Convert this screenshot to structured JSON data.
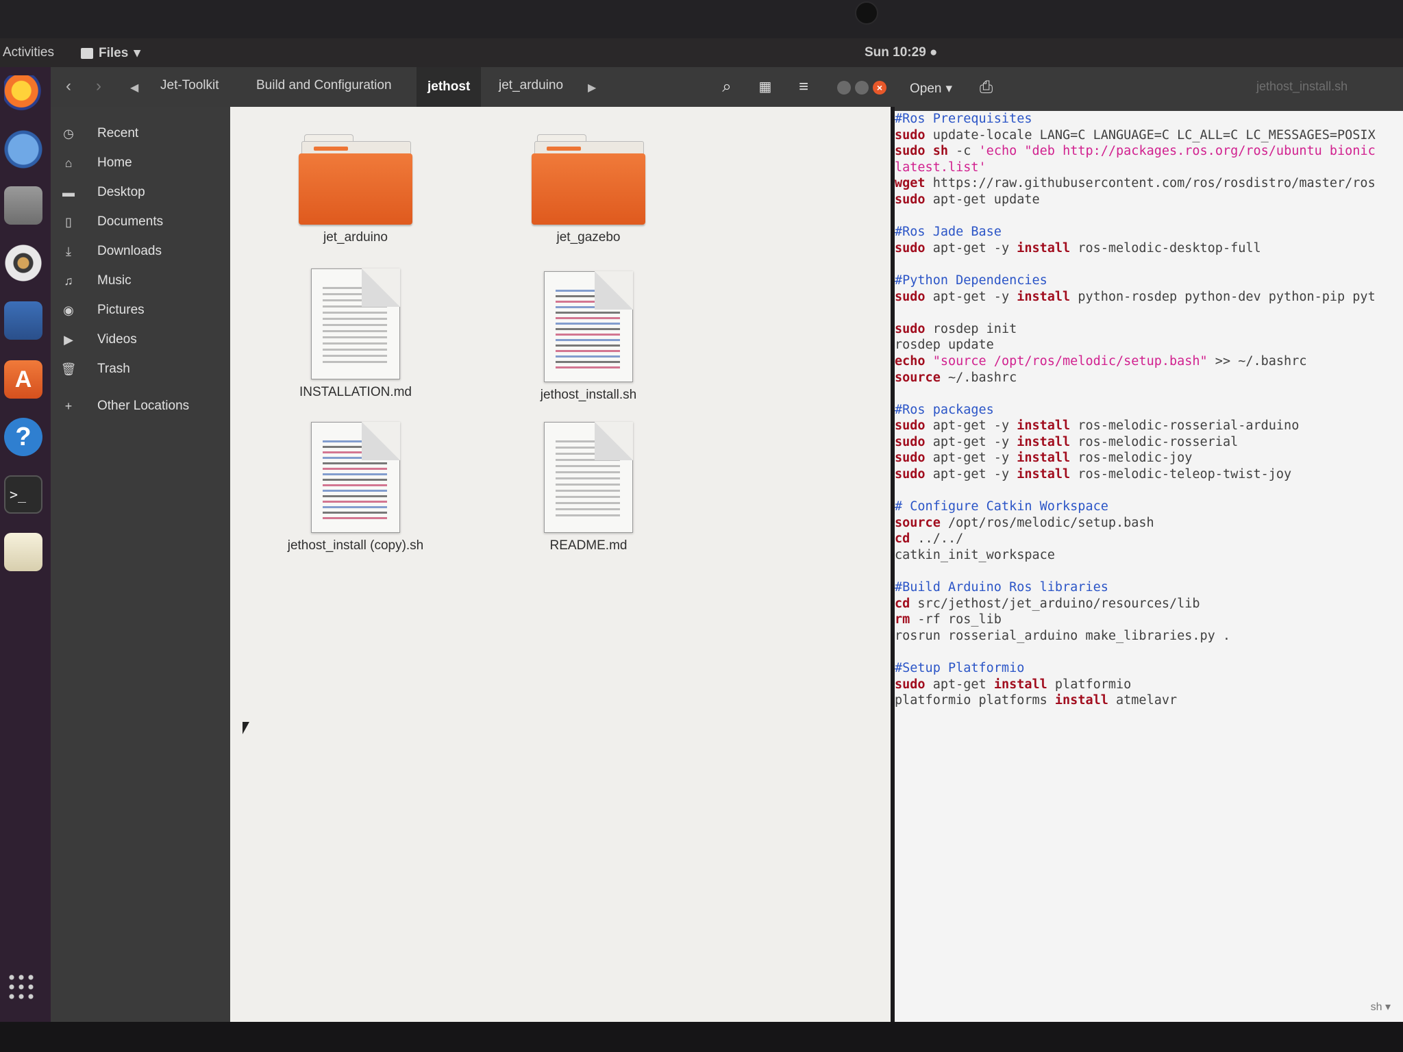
{
  "topbar": {
    "activities": "Activities",
    "app_menu": "Files",
    "clock": "Sun 10:29 ●"
  },
  "dock": {
    "items": [
      "firefox-icon",
      "thunderbird-icon",
      "files-icon",
      "rhythmbox-icon",
      "libreoffice-writer-icon",
      "software-icon",
      "help-icon",
      "terminal-icon",
      "text-editor-icon"
    ]
  },
  "files_window": {
    "breadcrumbs": [
      "Jet-Toolkit",
      "Build and Configuration",
      "jethost",
      "jet_arduino"
    ],
    "active_breadcrumb": "jethost",
    "sidebar": [
      {
        "icon": "clock-icon",
        "label": "Recent"
      },
      {
        "icon": "home-icon",
        "label": "Home"
      },
      {
        "icon": "folder-icon",
        "label": "Desktop"
      },
      {
        "icon": "document-icon",
        "label": "Documents"
      },
      {
        "icon": "download-icon",
        "label": "Downloads"
      },
      {
        "icon": "music-icon",
        "label": "Music"
      },
      {
        "icon": "camera-icon",
        "label": "Pictures"
      },
      {
        "icon": "video-icon",
        "label": "Videos"
      },
      {
        "icon": "trash-icon",
        "label": "Trash"
      },
      {
        "icon": "plus-icon",
        "label": "Other Locations"
      }
    ],
    "items": [
      {
        "name": "jet_arduino",
        "type": "folder"
      },
      {
        "name": "jet_gazebo",
        "type": "folder"
      },
      {
        "name": "INSTALLATION.md",
        "type": "text"
      },
      {
        "name": "jethost_install.sh",
        "type": "script"
      },
      {
        "name": "jethost_install (copy).sh",
        "type": "script"
      },
      {
        "name": "README.md",
        "type": "text"
      }
    ]
  },
  "editor": {
    "open_label": "Open",
    "title": "jethost_install.sh",
    "language": "sh",
    "code": [
      [
        [
          "cm",
          "#Ros Prerequisites"
        ]
      ],
      [
        [
          "kw",
          "sudo"
        ],
        [
          "t",
          " update-locale LANG=C LANGUAGE=C LC_ALL=C LC_MESSAGES=POSIX"
        ]
      ],
      [
        [
          "kw",
          "sudo"
        ],
        [
          "t",
          " "
        ],
        [
          "kw",
          "sh"
        ],
        [
          "t",
          " -c "
        ],
        [
          "st",
          "'echo \"deb http://packages.ros.org/ros/ubuntu bionic"
        ]
      ],
      [
        [
          "st",
          "latest.list'"
        ]
      ],
      [
        [
          "kw",
          "wget"
        ],
        [
          "t",
          " https://raw.githubusercontent.com/ros/rosdistro/master/ros"
        ]
      ],
      [
        [
          "kw",
          "sudo"
        ],
        [
          "t",
          " apt-get update"
        ]
      ],
      [
        [
          "t",
          ""
        ]
      ],
      [
        [
          "cm",
          "#Ros Jade Base"
        ]
      ],
      [
        [
          "kw",
          "sudo"
        ],
        [
          "t",
          " apt-get -y "
        ],
        [
          "kw",
          "install"
        ],
        [
          "t",
          " ros-melodic-desktop-full"
        ]
      ],
      [
        [
          "t",
          ""
        ]
      ],
      [
        [
          "cm",
          "#Python Dependencies"
        ]
      ],
      [
        [
          "kw",
          "sudo"
        ],
        [
          "t",
          " apt-get -y "
        ],
        [
          "kw",
          "install"
        ],
        [
          "t",
          " python-rosdep python-dev python-pip pyt"
        ]
      ],
      [
        [
          "t",
          ""
        ]
      ],
      [
        [
          "kw",
          "sudo"
        ],
        [
          "t",
          " rosdep init"
        ]
      ],
      [
        [
          "t",
          "rosdep update"
        ]
      ],
      [
        [
          "kw",
          "echo"
        ],
        [
          "t",
          " "
        ],
        [
          "st",
          "\"source /opt/ros/melodic/setup.bash\""
        ],
        [
          "t",
          " >> ~/.bashrc"
        ]
      ],
      [
        [
          "kw",
          "source"
        ],
        [
          "t",
          " ~/.bashrc"
        ]
      ],
      [
        [
          "t",
          ""
        ]
      ],
      [
        [
          "cm",
          "#Ros packages"
        ]
      ],
      [
        [
          "kw",
          "sudo"
        ],
        [
          "t",
          " apt-get -y "
        ],
        [
          "kw",
          "install"
        ],
        [
          "t",
          " ros-melodic-rosserial-arduino"
        ]
      ],
      [
        [
          "kw",
          "sudo"
        ],
        [
          "t",
          " apt-get -y "
        ],
        [
          "kw",
          "install"
        ],
        [
          "t",
          " ros-melodic-rosserial"
        ]
      ],
      [
        [
          "kw",
          "sudo"
        ],
        [
          "t",
          " apt-get -y "
        ],
        [
          "kw",
          "install"
        ],
        [
          "t",
          " ros-melodic-joy"
        ]
      ],
      [
        [
          "kw",
          "sudo"
        ],
        [
          "t",
          " apt-get -y "
        ],
        [
          "kw",
          "install"
        ],
        [
          "t",
          " ros-melodic-teleop-twist-joy"
        ]
      ],
      [
        [
          "t",
          ""
        ]
      ],
      [
        [
          "cm",
          "# Configure Catkin Workspace"
        ]
      ],
      [
        [
          "kw",
          "source"
        ],
        [
          "t",
          " /opt/ros/melodic/setup.bash"
        ]
      ],
      [
        [
          "kw",
          "cd"
        ],
        [
          "t",
          " ../../"
        ]
      ],
      [
        [
          "t",
          "catkin_init_workspace"
        ]
      ],
      [
        [
          "t",
          ""
        ]
      ],
      [
        [
          "cm",
          "#Build Arduino Ros libraries"
        ]
      ],
      [
        [
          "kw",
          "cd"
        ],
        [
          "t",
          " src/jethost/jet_arduino/resources/lib"
        ]
      ],
      [
        [
          "kw",
          "rm"
        ],
        [
          "t",
          " -rf ros_lib"
        ]
      ],
      [
        [
          "t",
          "rosrun rosserial_arduino make_libraries.py ."
        ]
      ],
      [
        [
          "t",
          ""
        ]
      ],
      [
        [
          "cm",
          "#Setup Platformio"
        ]
      ],
      [
        [
          "kw",
          "sudo"
        ],
        [
          "t",
          " apt-get "
        ],
        [
          "kw",
          "install"
        ],
        [
          "t",
          " platformio"
        ]
      ],
      [
        [
          "t",
          "platformio platforms "
        ],
        [
          "kw",
          "install"
        ],
        [
          "t",
          " atmelavr"
        ]
      ]
    ]
  },
  "colors": {
    "folder_orange": "#e8652a",
    "comment_blue": "#2b55c7",
    "keyword_red": "#a10d1e",
    "string_pink": "#d1218f"
  }
}
